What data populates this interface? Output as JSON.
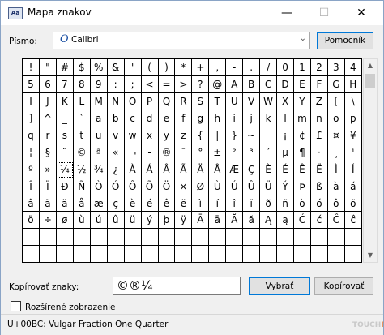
{
  "window": {
    "title": "Mapa znakov",
    "app_icon": "charmap-app-icon"
  },
  "font_row": {
    "label": "Písmo:",
    "selected_font": "Calibri",
    "font_icon": "O",
    "help_label": "Pomocník"
  },
  "grid": {
    "rows": [
      [
        "!",
        "\"",
        "#",
        "$",
        "%",
        "&",
        "'",
        "(",
        ")",
        "*",
        "+",
        ",",
        "-",
        ".",
        "/",
        "0",
        "1",
        "2",
        "3",
        "4"
      ],
      [
        "5",
        "6",
        "7",
        "8",
        "9",
        ":",
        ";",
        "<",
        "=",
        ">",
        "?",
        "@",
        "A",
        "B",
        "C",
        "D",
        "E",
        "F",
        "G",
        "H"
      ],
      [
        "I",
        "J",
        "K",
        "L",
        "M",
        "N",
        "O",
        "P",
        "Q",
        "R",
        "S",
        "T",
        "U",
        "V",
        "W",
        "X",
        "Y",
        "Z",
        "[",
        "\\"
      ],
      [
        "]",
        "^",
        "_",
        "`",
        "a",
        "b",
        "c",
        "d",
        "e",
        "f",
        "g",
        "h",
        "i",
        "j",
        "k",
        "l",
        "m",
        "n",
        "o",
        "p"
      ],
      [
        "q",
        "r",
        "s",
        "t",
        "u",
        "v",
        "w",
        "x",
        "y",
        "z",
        "{",
        "|",
        "}",
        "~",
        " ",
        "¡",
        "¢",
        "£",
        "¤",
        "¥"
      ],
      [
        "¦",
        "§",
        "¨",
        "©",
        "ª",
        "«",
        "¬",
        "-",
        "®",
        "¯",
        "°",
        "±",
        "²",
        "³",
        "´",
        "µ",
        "¶",
        "·",
        "¸",
        "¹"
      ],
      [
        "º",
        "»",
        "¼",
        "½",
        "¾",
        "¿",
        "À",
        "Á",
        "Â",
        "Ã",
        "Ä",
        "Å",
        "Æ",
        "Ç",
        "È",
        "É",
        "Ê",
        "Ë",
        "Ì",
        "Í"
      ],
      [
        "Î",
        "Ï",
        "Ð",
        "Ñ",
        "Ò",
        "Ó",
        "Ô",
        "Õ",
        "Ö",
        "×",
        "Ø",
        "Ù",
        "Ú",
        "Û",
        "Ü",
        "Ý",
        "Þ",
        "ß",
        "à",
        "á"
      ],
      [
        "â",
        "ã",
        "ä",
        "å",
        "æ",
        "ç",
        "è",
        "é",
        "ê",
        "ë",
        "ì",
        "í",
        "î",
        "ï",
        "ð",
        "ñ",
        "ò",
        "ó",
        "ô",
        "õ"
      ],
      [
        "ö",
        "÷",
        "ø",
        "ù",
        "ú",
        "û",
        "ü",
        "ý",
        "þ",
        "ÿ",
        "Ā",
        "ā",
        "Ă",
        "ă",
        "Ą",
        "ą",
        "Ć",
        "ć",
        "Ĉ",
        "ĉ"
      ]
    ],
    "selected": {
      "row": 6,
      "col": 2
    }
  },
  "copy_row": {
    "label": "Kopírovať znaky:",
    "value": "©®¼",
    "select_label": "Vybrať",
    "copy_label": "Kopírovať"
  },
  "advanced": {
    "label": "Rozšírené zobrazenie",
    "checked": false
  },
  "status": {
    "text": "U+00BC: Vulgar Fraction One Quarter"
  },
  "watermark": {
    "part1": "TOUCH",
    "part2": "IT"
  },
  "colors": {
    "accent": "#0078d7",
    "background": "#f0f0f0"
  }
}
